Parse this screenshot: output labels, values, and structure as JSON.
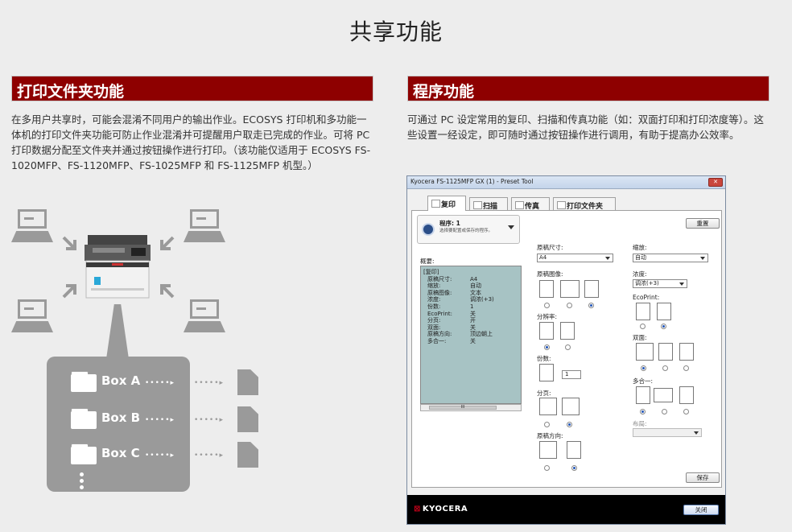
{
  "page_title": "共享功能",
  "left": {
    "heading": "打印文件夹功能",
    "text": "在多用户共享时，可能会混淆不同用户的输出作业。ECOSYS 打印机和多功能一体机的打印文件夹功能可防止作业混淆并可提醒用户取走已完成的作业。可将 PC 打印数据分配至文件夹并通过按钮操作进行打印。（该功能仅适用于 ECOSYS FS-1020MFP、FS-1120MFP、FS-1025MFP 和 FS-1125MFP 机型。）",
    "boxes": [
      "Box A",
      "Box B",
      "Box C"
    ],
    "dots_in": "•••••▸",
    "dots_out": "•••••▸"
  },
  "right": {
    "heading": "程序功能",
    "text": "可通过 PC 设定常用的复印、扫描和传真功能（如：双面打印和打印浓度等）。这些设置一经设定，即可随时通过按钮操作进行调用，有助于提高办公效率。"
  },
  "window": {
    "title": "Kyocera FS-1125MFP GX (1) - Preset Tool",
    "close": "✕",
    "tabs": [
      "复印",
      "扫描",
      "传真",
      "打印文件夹"
    ],
    "program_name": "程序: 1",
    "program_hint": "选择要配置或保存的程序。",
    "reset": "重置",
    "summary_label": "概要:",
    "summary_header": "[复印]",
    "summary_rows": [
      {
        "k": "原稿尺寸:",
        "v": "A4"
      },
      {
        "k": "缩放:",
        "v": "自动"
      },
      {
        "k": "原稿图像:",
        "v": "文本"
      },
      {
        "k": "浓度:",
        "v": "调浓(+3)"
      },
      {
        "k": "份数:",
        "v": "1"
      },
      {
        "k": "EcoPrint:",
        "v": "关"
      },
      {
        "k": "分页:",
        "v": "开"
      },
      {
        "k": "双面:",
        "v": "关"
      },
      {
        "k": "原稿方向:",
        "v": "顶边朝上"
      },
      {
        "k": "多合一:",
        "v": "关"
      }
    ],
    "scroll_text": "III",
    "size_label": "原稿尺寸:",
    "size_value": "A4",
    "image_label": "原稿图像:",
    "resolution_label": "分辨率:",
    "copies_label": "份数:",
    "copies_value": "1",
    "collate_label": "分页:",
    "orient_label": "原稿方向:",
    "zoom_label": "缩放:",
    "zoom_value": "自动",
    "density_label": "浓度:",
    "density_value": "调浓(+3)",
    "eco_label": "EcoPrint:",
    "duplex_label": "双面:",
    "combine_label": "多合一:",
    "layout_label": "布局:",
    "save": "保存",
    "logo": "KYOCERA",
    "logo_mark": "⊠",
    "close_btn": "关闭"
  },
  "colors": {
    "section_bar": "#8e0000",
    "illustration_gray": "#9a9a9a",
    "summary_bg": "#a7c3c4"
  }
}
